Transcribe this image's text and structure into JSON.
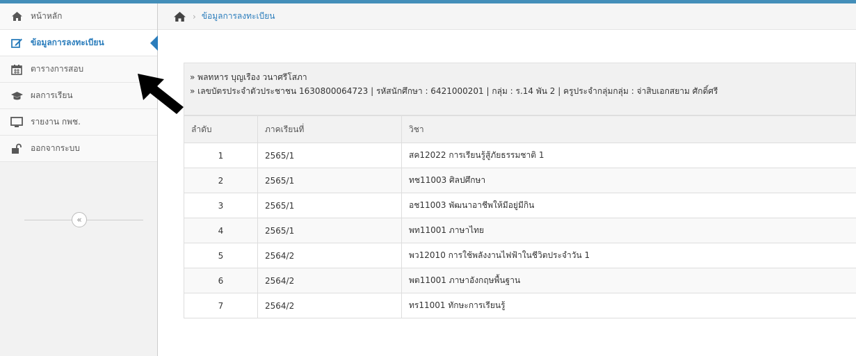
{
  "sidebar": {
    "items": [
      {
        "label": "หน้าหลัก",
        "icon": "home-icon"
      },
      {
        "label": "ข้อมูลการลงทะเบียน",
        "icon": "edit-icon",
        "active": true
      },
      {
        "label": "ตารางการสอบ",
        "icon": "calendar-icon"
      },
      {
        "label": "ผลการเรียน",
        "icon": "graduation-cap-icon"
      },
      {
        "label": "รายงาน กพช.",
        "icon": "desktop-icon"
      },
      {
        "label": "ออกจากระบบ",
        "icon": "unlock-icon"
      }
    ],
    "collapse_glyph": "«"
  },
  "breadcrumb": {
    "separator": "›",
    "current": "ข้อมูลการลงทะเบียน"
  },
  "student": {
    "name_line": "» พลทหาร บุญเรือง วนาศรีโสภา",
    "detail_line": "» เลขบัตรประจำตัวประชาชน 1630800064723 | รหัสนักศึกษา : 6421000201 | กลุ่ม : ร.14 พัน 2 | ครูประจำกลุ่มกลุ่ม : จ่าสิบเอกสยาม ศักดิ์ศรี"
  },
  "table": {
    "headers": [
      "ลำดับ",
      "ภาคเรียนที่",
      "วิชา"
    ],
    "rows": [
      {
        "no": "1",
        "term": "2565/1",
        "subject": "สค12022 การเรียนรู้สู้ภัยธรรมชาติ 1"
      },
      {
        "no": "2",
        "term": "2565/1",
        "subject": "ทช11003 ศิลปศึกษา"
      },
      {
        "no": "3",
        "term": "2565/1",
        "subject": "อช11003 พัฒนาอาชีพให้มีอยู่มีกิน"
      },
      {
        "no": "4",
        "term": "2565/1",
        "subject": "พท11001 ภาษาไทย"
      },
      {
        "no": "5",
        "term": "2564/2",
        "subject": "พว12010 การใช้พลังงานไฟฟ้าในชีวิตประจำวัน 1"
      },
      {
        "no": "6",
        "term": "2564/2",
        "subject": "พต11001 ภาษาอังกฤษพื้นฐาน"
      },
      {
        "no": "7",
        "term": "2564/2",
        "subject": "ทร11001 ทักษะการเรียนรู้"
      }
    ]
  },
  "colors": {
    "accent": "#438eb9",
    "link": "#2b7dbc",
    "arrow": "#000000"
  }
}
